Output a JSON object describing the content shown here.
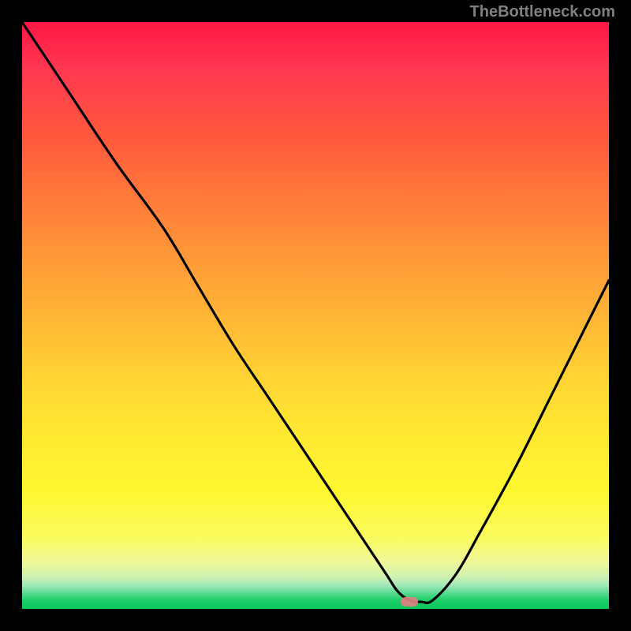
{
  "watermark": "TheBottleneck.com",
  "chart_data": {
    "type": "line",
    "title": "",
    "xlabel": "",
    "ylabel": "",
    "xlim": [
      0,
      100
    ],
    "ylim": [
      0,
      100
    ],
    "background": "red-yellow-green vertical gradient (red top, green bottom)",
    "series": [
      {
        "name": "bottleneck-curve",
        "x": [
          0,
          8,
          16,
          24,
          30,
          36,
          42,
          48,
          54,
          58,
          62,
          64,
          66,
          68,
          70,
          74,
          78,
          84,
          90,
          96,
          100
        ],
        "y": [
          100,
          88,
          76,
          65,
          55,
          45,
          36,
          27,
          18,
          12,
          6,
          3,
          1.5,
          1.2,
          1.5,
          6,
          13,
          24,
          36,
          48,
          56
        ]
      }
    ],
    "marker": {
      "x": 66,
      "y": 1.2,
      "color": "#e08080"
    },
    "gradient_stops": [
      {
        "pos": 0,
        "color": "#ff1744"
      },
      {
        "pos": 50,
        "color": "#ffd234"
      },
      {
        "pos": 88,
        "color": "#fbfb60"
      },
      {
        "pos": 100,
        "color": "#07c85a"
      }
    ]
  }
}
